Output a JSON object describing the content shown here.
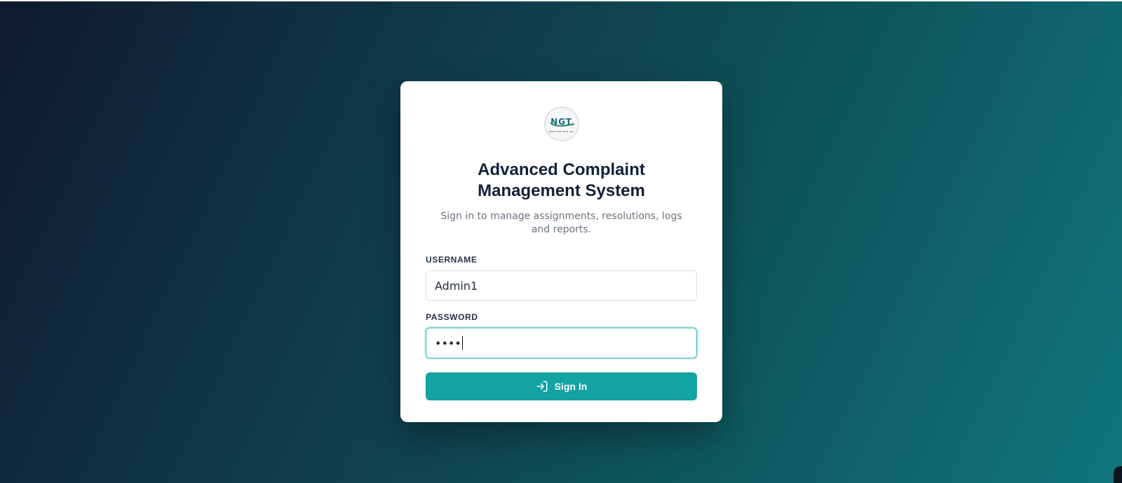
{
  "logo": {
    "text": "NGT",
    "subtext": "NEXT GEN TEAM LTD"
  },
  "login": {
    "title": "Advanced Complaint Management System",
    "subtitle": "Sign in to manage assignments, resolutions, logs and reports.",
    "username_label": "USERNAME",
    "username_value": "Admin1",
    "password_label": "PASSWORD",
    "password_value": "••••",
    "signin_label": "Sign In",
    "signin_icon": "login-icon"
  },
  "colors": {
    "accent": "#13a3a3",
    "title": "#12203a",
    "background_start": "#0f1a2e",
    "background_end": "#10767a"
  }
}
